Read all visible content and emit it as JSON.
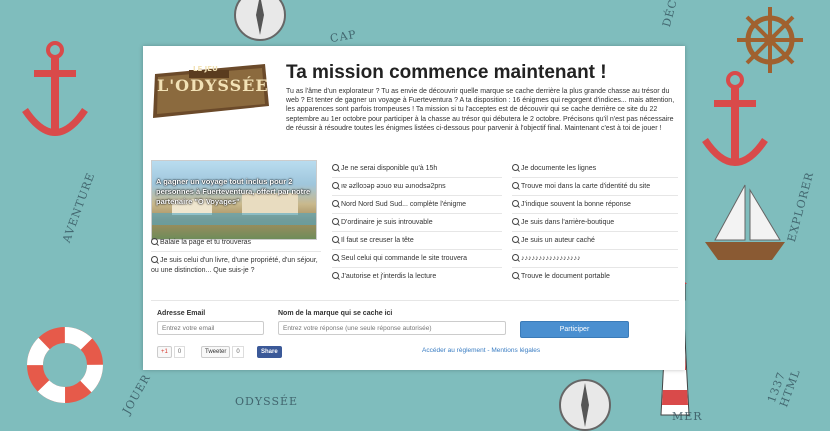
{
  "background": {
    "texts": [
      "CAP",
      "DÉCOUVERTE",
      "AVENTURE",
      "EXPLORER",
      "ODYSSÉE",
      "JOUER",
      "MER",
      "1337 HTML"
    ]
  },
  "colors": {
    "background": "#7fbdbd",
    "accent_red": "#d94a4a",
    "button": "#4a8fd0",
    "link": "#3a7dc3"
  },
  "logo": {
    "small": "LE JEU",
    "name": "L'ODYSSÉE"
  },
  "title": "Ta mission commence maintenant !",
  "intro": "Tu as l'âme d'un explorateur ? Tu as envie de découvrir quelle marque se cache derrière la plus grande chasse au trésor du web ? Et tenter de gagner un voyage à Fuerteventura ? A ta disposition : 16 énigmes qui regorgent d'indices... mais attention, les apparences sont parfois trompeuses ! Ta mission si tu l'acceptes est de découvrir qui se cache derrière ce site du 22 septembre au 1er octobre pour participer à la chasse au trésor qui débutera le 2 octobre. Précisons qu'il n'est pas nécessaire de réussir à résoudre toutes les énigmes listées ci-dessous pour parvenir à l'objectif final. Maintenant c'est à toi de jouer !",
  "promo": {
    "text": "A gagner un voyage tout inclus pour 2 personnes à Fuerteventura, offert par notre partenaire \"O Voyages\""
  },
  "clues": {
    "col1": [
      "Balaie la page et tu trouveras",
      "Je suis celui d'un livre, d'une propriété, d'un séjour, ou une distinction... Que suis-je ?"
    ],
    "col2": [
      "Je ne serai disponible qu'à 15h",
      "ıɐ ǝzlloɔǝp ǝɔuo ɐɯ ǝɹnodsǝ2pns",
      "Nord Nord Sud Sud... complète l'énigme",
      "D'ordinaire je suis introuvable",
      "Il faut se creuser la tête",
      "Seul celui qui commande le site trouvera",
      "J'autorise et j'interdis la lecture"
    ],
    "col3": [
      "Je documente les lignes",
      "Trouve moi dans la carte d'identité du site",
      "J'indique souvent la bonne réponse",
      "Je suis dans l'arrière-boutique",
      "Je suis un auteur caché",
      "♪♪♪♪♪♪♪♪♪♪♪♪♪♪♪♪♪",
      "Trouve le document portable"
    ]
  },
  "form": {
    "email_label": "Adresse Email",
    "email_placeholder": "Entrez votre email",
    "brand_label": "Nom de la marque qui se cache ici",
    "brand_placeholder": "Entrez votre réponse (une seule réponse autorisée)",
    "submit": "Participer"
  },
  "social": {
    "gplus": "+1",
    "gplus_count": "0",
    "tweet": "Tweeter",
    "tweet_count": "0",
    "share": "Share"
  },
  "footer": {
    "rules": "Accéder au règlement",
    "separator": "-",
    "legal": "Mentions légales"
  }
}
